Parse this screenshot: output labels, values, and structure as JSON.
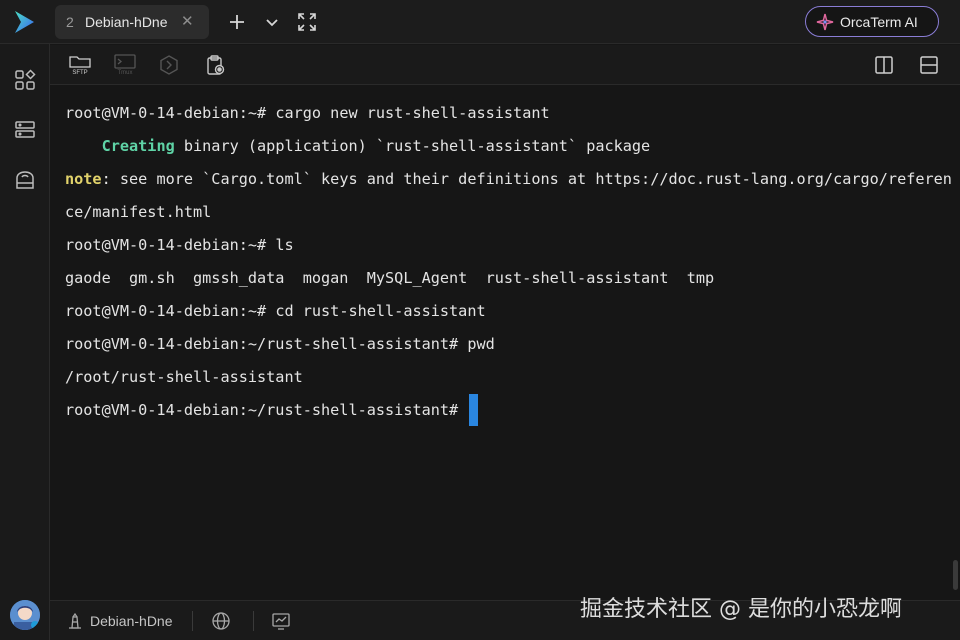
{
  "app": {
    "icon": "orcaterm-logo"
  },
  "tabs": [
    {
      "number": "2",
      "title": "Debian-hDne",
      "close_glyph": "✕"
    }
  ],
  "top_actions": {
    "new_tab_icon": "plus-icon",
    "dropdown_icon": "chevron-down-icon",
    "fullscreen_icon": "expand-icon",
    "ai_button_label": "OrcaTerm AI"
  },
  "sidebar": {
    "items": [
      "apps-icon",
      "server-list-icon",
      "cloud-disk-icon"
    ]
  },
  "toolbar": {
    "sftp_label": "SFTP",
    "tmux_label": "Tmux",
    "items": [
      "sftp-icon",
      "tmux-icon",
      "kube-icon",
      "clipboard-record-icon"
    ],
    "right_items": [
      "split-vertical-icon",
      "split-horizontal-icon"
    ]
  },
  "terminal": {
    "lines": [
      {
        "prompt": "root@VM-0-14-debian:~# ",
        "command": "cargo new rust-shell-assistant"
      },
      {
        "indent": "    ",
        "highlight": "Creating",
        "rest": " binary (application) `rust-shell-assistant` package"
      },
      {
        "highlight": "note",
        "rest": ": see more `Cargo.toml` keys and their definitions at https://doc.rust-lang.org/cargo/referen"
      },
      {
        "text": "ce/manifest.html"
      },
      {
        "prompt": "root@VM-0-14-debian:~# ",
        "command": "ls"
      },
      {
        "text": "gaode  gm.sh  gmssh_data  mogan  MySQL_Agent  rust-shell-assistant  tmp"
      },
      {
        "prompt": "root@VM-0-14-debian:~# ",
        "command": "cd rust-shell-assistant"
      },
      {
        "prompt": "root@VM-0-14-debian:~/rust-shell-assistant# ",
        "command": "pwd"
      },
      {
        "text": "/root/rust-shell-assistant"
      },
      {
        "prompt": "root@VM-0-14-debian:~/rust-shell-assistant# ",
        "command": ""
      }
    ],
    "colors": {
      "success": "#5fd3a6",
      "note": "#e2d36b",
      "cursor": "#2a86e0"
    }
  },
  "statusbar": {
    "host": "Debian-hDne",
    "host_icon": "lighthouse-icon",
    "icons": [
      "globe-icon",
      "monitor-chart-icon"
    ]
  },
  "watermark": "掘金技术社区 @ 是你的小恐龙啊"
}
